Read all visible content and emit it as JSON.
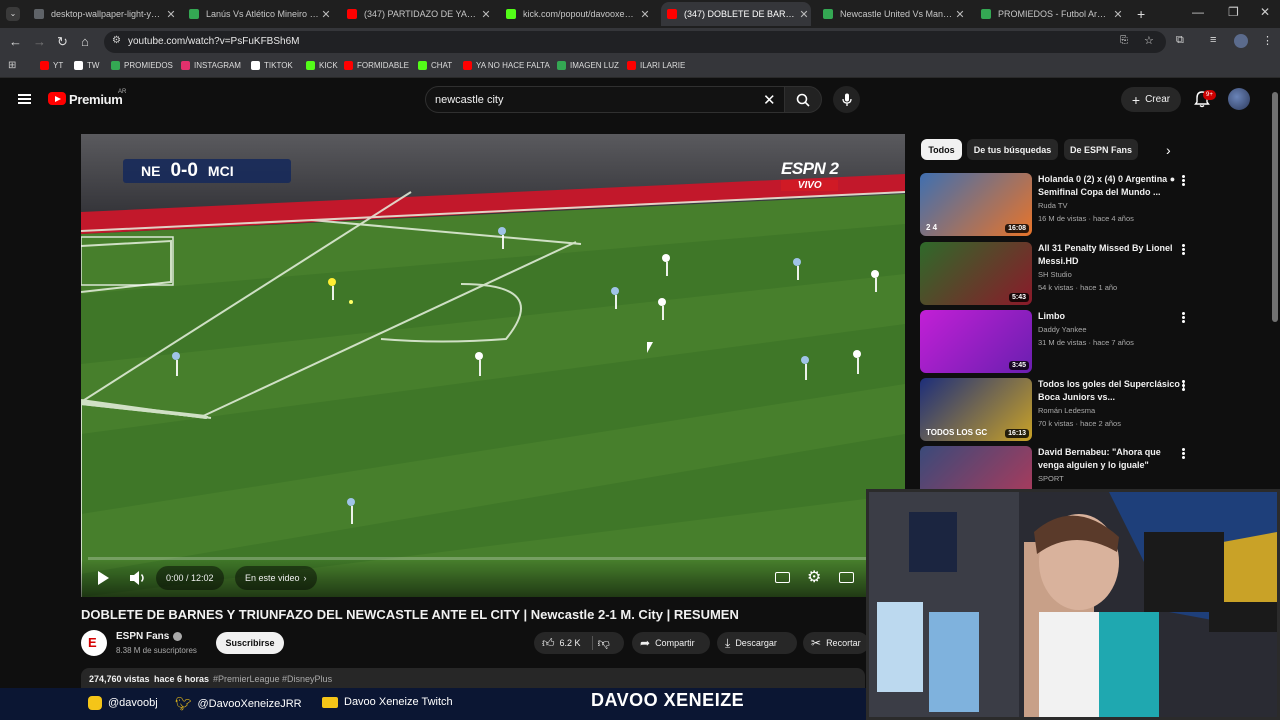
{
  "browser": {
    "tabs": [
      {
        "title": "desktop-wallpaper-light-yellow",
        "favicon_color": "#5f6368",
        "active": false
      },
      {
        "title": "Lanús Vs Atlético Mineiro - Alin",
        "favicon_color": "#34a853",
        "active": false
      },
      {
        "title": "(347) PARTIDAZO DE YAMAL Y",
        "favicon_color": "#ff0000",
        "active": false
      },
      {
        "title": "kick.com/popout/davooxeneize",
        "favicon_color": "#53fc18",
        "active": false
      },
      {
        "title": "(347) DOBLETE DE BARNES Y TR",
        "favicon_color": "#ff0000",
        "active": true
      },
      {
        "title": "Newcastle United Vs Manchester",
        "favicon_color": "#34a853",
        "active": false
      },
      {
        "title": "PROMIEDOS - Futbol Argentino",
        "favicon_color": "#34a853",
        "active": false
      }
    ],
    "url": "youtube.com/watch?v=PsFuKFBSh6M",
    "bookmarks": [
      {
        "label": "YT",
        "icon": "youtube-icon",
        "color": "#ff0000"
      },
      {
        "label": "TW",
        "icon": "x-icon",
        "color": "#ffffff"
      },
      {
        "label": "PROMIEDOS",
        "icon": "promiedos-icon",
        "color": "#34a853"
      },
      {
        "label": "INSTAGRAM",
        "icon": "instagram-icon",
        "color": "#e1306c"
      },
      {
        "label": "TIKTOK",
        "icon": "tiktok-icon",
        "color": "#ffffff"
      },
      {
        "label": "KICK",
        "icon": "kick-icon",
        "color": "#53fc18"
      },
      {
        "label": "FORMIDABLE",
        "icon": "youtube-icon",
        "color": "#ff0000"
      },
      {
        "label": "CHAT",
        "icon": "kick-icon",
        "color": "#53fc18"
      },
      {
        "label": "YA NO HACE FALTA",
        "icon": "youtube-icon",
        "color": "#ff0000"
      },
      {
        "label": "IMAGEN LUZ",
        "icon": "promiedos-icon",
        "color": "#34a853"
      },
      {
        "label": "ILARI LARIE",
        "icon": "youtube-icon",
        "color": "#ff0000"
      }
    ]
  },
  "youtube": {
    "brand": "Premium",
    "region": "AR",
    "search_query": "newcastle city",
    "create_label": "Crear",
    "notification_count": "9+"
  },
  "player": {
    "score_home": "NE",
    "score": "0-0",
    "score_away": "MCI",
    "broadcaster": "ESPN 2",
    "broadcaster_tag": "VIVO",
    "time_display": "0:00 / 12:02",
    "chapter_label": "En este video",
    "progress_fraction": 0.0
  },
  "video": {
    "title": "DOBLETE DE BARNES Y TRIUNFAZO DEL NEWCASTLE ANTE EL CITY | Newcastle 2-1 M. City | RESUMEN",
    "channel": "ESPN Fans",
    "subscribers": "8.38 M de suscriptores",
    "subscribe_label": "Suscribirse",
    "likes": "6.2 K",
    "share_label": "Compartir",
    "download_label": "Descargar",
    "clip_label": "Recortar",
    "views": "274,760 vistas",
    "age": "hace 6 horas",
    "hashtags": "#PremierLeague #DisneyPlus"
  },
  "sidebar": {
    "chips": [
      "Todos",
      "De tus búsquedas",
      "De ESPN Fans"
    ],
    "recommendations": [
      {
        "title": "Holanda 0 (2) x (4) 0 Argentina ● Semifinal Copa del Mundo ...",
        "channel": "Ruda TV",
        "meta": "16 M de vistas · hace 4 años",
        "duration": "16:08",
        "thumb_a": "#3f6fb0",
        "thumb_b": "#e8742a",
        "thumb_text": "2 4"
      },
      {
        "title": "All 31 Penalty Missed By Lionel Messi.HD",
        "channel": "SH Studio",
        "meta": "54 k vistas · hace 1 año",
        "duration": "5:43",
        "thumb_a": "#2e6a2a",
        "thumb_b": "#8b1a2a",
        "thumb_text": ""
      },
      {
        "title": "Limbo",
        "channel": "Daddy Yankee",
        "meta": "31 M de vistas · hace 7 años",
        "duration": "3:45",
        "thumb_a": "#c21fd6",
        "thumb_b": "#6a1fb0",
        "thumb_text": ""
      },
      {
        "title": "Todos los goles del Superclásico | Boca Juniors vs...",
        "channel": "Román Ledesma",
        "meta": "70 k vistas · hace 2 años",
        "duration": "16:13",
        "thumb_a": "#1d2e7a",
        "thumb_b": "#c9a227",
        "thumb_text": "TODOS LOS GC"
      },
      {
        "title": "David Bernabeu: \"Ahora que venga alguien y lo iguale\"",
        "channel": "SPORT",
        "meta": "",
        "duration": "",
        "thumb_a": "#3a4a7a",
        "thumb_b": "#b23a5a",
        "thumb_text": "SPORT"
      }
    ]
  },
  "overlay": {
    "instagram": "@davoobj",
    "twitter": "@DavooXeneizeJRR",
    "twitch": "Davoo Xeneize Twitch",
    "stream_name": "DAVOO XENEIZE"
  }
}
